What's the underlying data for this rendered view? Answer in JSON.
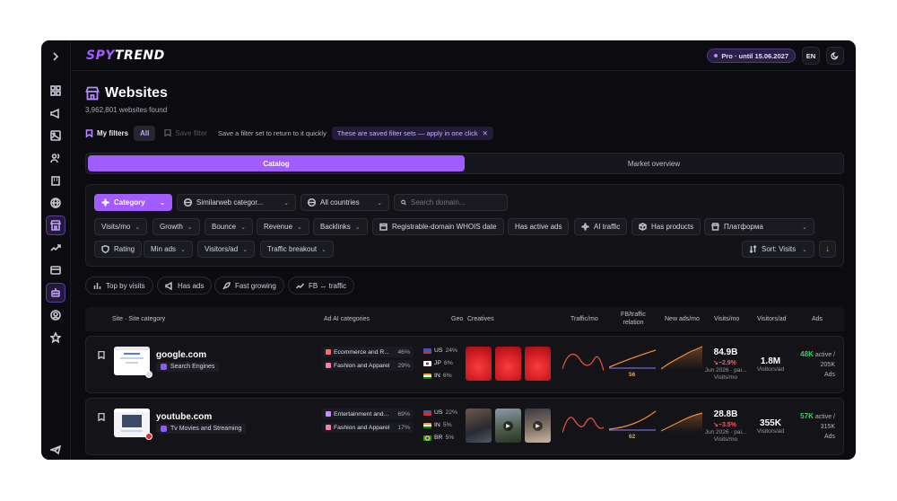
{
  "app": {
    "logo_part1": "SPY",
    "logo_part2": "TREND",
    "pro_badge": "Pro · until 15.06.2027",
    "language": "EN"
  },
  "page": {
    "title": "Websites",
    "subtitle": "3,962,801 websites found"
  },
  "filters_bar": {
    "my_filters": "My filters",
    "all": "All",
    "save_filter": "Save filter",
    "hint": "Save a filter set to return to it quickly",
    "saved_chip": "These are saved filter sets — apply in one click"
  },
  "tabs": [
    "Catalog",
    "Market overview"
  ],
  "filters": {
    "category": "Category",
    "similarweb": "Similarweb categor...",
    "countries": "All countries",
    "search_placeholder": "Search domain...",
    "row2": [
      "Visits/mo",
      "Growth",
      "Bounce",
      "Revenue",
      "Backlinks"
    ],
    "whois": "Registrable-domain WHOIS date",
    "has_active_ads": "Has active ads",
    "ai_traffic": "AI traffic",
    "has_products": "Has products",
    "platform": "Платформа",
    "rating": "Rating",
    "min_ads": "Min ads",
    "visitors_ad": "Visitors/ad",
    "traffic_breakout": "Traffic breakout",
    "sort": "Sort: Visits"
  },
  "quick_filters": [
    "Top by visits",
    "Has ads",
    "Fast growing",
    "FB ↔ traffic"
  ],
  "table": {
    "headers": {
      "site": "Site · Site category",
      "ad_ai": "Ad AI categories",
      "geo": "Geo",
      "creatives": "Creatives",
      "traffic": "Traffic/mo",
      "fb_relation_1": "FB/traffic",
      "fb_relation_2": "relation",
      "new_ads": "New ads/mo",
      "visits": "Visits/mo",
      "visitors_ad": "Visitors/ad",
      "ads": "Ads"
    },
    "rows": [
      {
        "domain": "google.com",
        "category": "Search Engines",
        "ad_categories": [
          {
            "name": "Ecommerce and R...",
            "pct": "46%"
          },
          {
            "name": "Fashion and Apparel",
            "pct": "29%"
          }
        ],
        "geo": [
          {
            "code": "US",
            "pct": "24%"
          },
          {
            "code": "JP",
            "pct": "6%"
          },
          {
            "code": "IN",
            "pct": "6%"
          }
        ],
        "fb_relation_value": "56",
        "visits": "84.9B",
        "visits_growth": "↘−2.9%",
        "visits_note": "Jun 2026 · pai...",
        "visits_label": "Visits/mo",
        "visitors_per_ad": "1.8M",
        "visitors_per_ad_label": "Visitors/ad",
        "ads_active": "48K",
        "ads_active_label": "active /",
        "ads_total": "205K",
        "ads_label": "Ads"
      },
      {
        "domain": "youtube.com",
        "category": "Tv Movies and Streaming",
        "ad_categories": [
          {
            "name": "Entertainment and...",
            "pct": "69%"
          },
          {
            "name": "Fashion and Apparel",
            "pct": "17%"
          }
        ],
        "geo": [
          {
            "code": "US",
            "pct": "22%"
          },
          {
            "code": "IN",
            "pct": "5%"
          },
          {
            "code": "BR",
            "pct": "5%"
          }
        ],
        "fb_relation_value": "62",
        "visits": "28.8B",
        "visits_growth": "↘−3.5%",
        "visits_note": "Jun 2026 · pai...",
        "visits_label": "Visits/mo",
        "visitors_per_ad": "355K",
        "visitors_per_ad_label": "Visitors/ad",
        "ads_active": "57K",
        "ads_active_label": "active /",
        "ads_total": "315K",
        "ads_label": "Ads"
      }
    ]
  },
  "colors": {
    "accent": "#a05cff",
    "background": "#0c0c10",
    "growth_negative": "#ff5a5a",
    "ads_active": "#34d06a",
    "spark_line": "#e0503a",
    "relation_line": "#f08a3c"
  }
}
